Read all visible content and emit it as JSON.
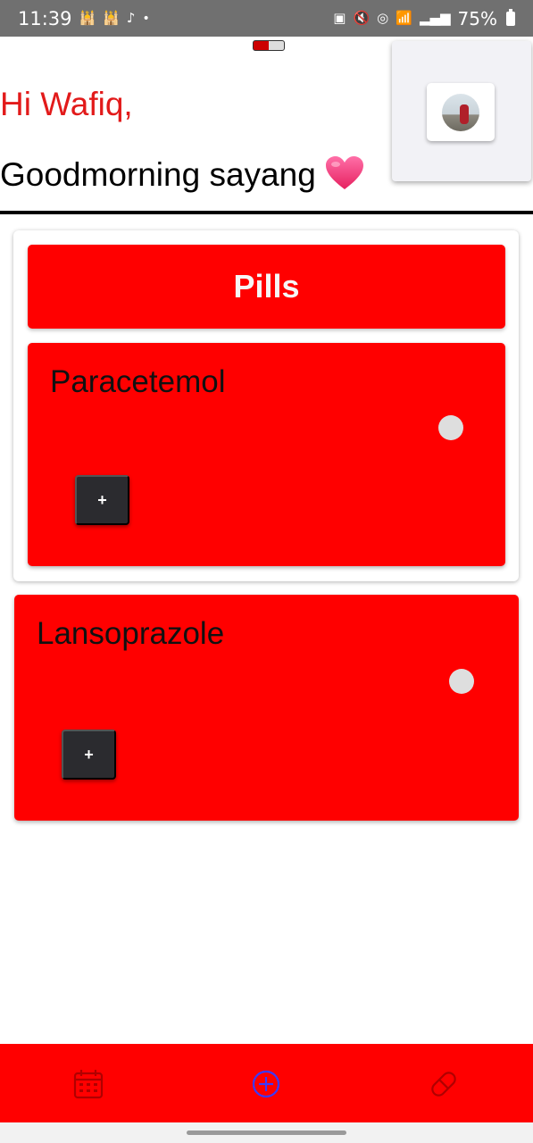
{
  "status_bar": {
    "time": "11:39",
    "battery": "75%",
    "left_icons": [
      "mosque-icon",
      "mosque-icon",
      "tiktok-icon",
      "dot-icon"
    ],
    "right_icons": [
      "nfc-icon",
      "mute-icon",
      "hotspot-icon",
      "wifi-icon",
      "signal-icon",
      "battery-icon"
    ]
  },
  "header": {
    "greeting": "Hi Wafiq,",
    "subtitle": "Goodmorning sayang",
    "emoji": "heart-icon"
  },
  "pills": {
    "title": "Pills",
    "items": [
      {
        "name": "Paracetemol",
        "add_label": "+"
      },
      {
        "name": "Lansoprazole",
        "add_label": "+"
      }
    ]
  },
  "bottom_nav": {
    "items": [
      "calendar-icon",
      "add-circle-icon",
      "pill-icon"
    ],
    "active": "add-circle-icon"
  },
  "colors": {
    "accent": "#ff0000",
    "greeting_name": "#e21a1a",
    "active_nav": "#3a3aff",
    "inactive_nav": "#b00000"
  }
}
